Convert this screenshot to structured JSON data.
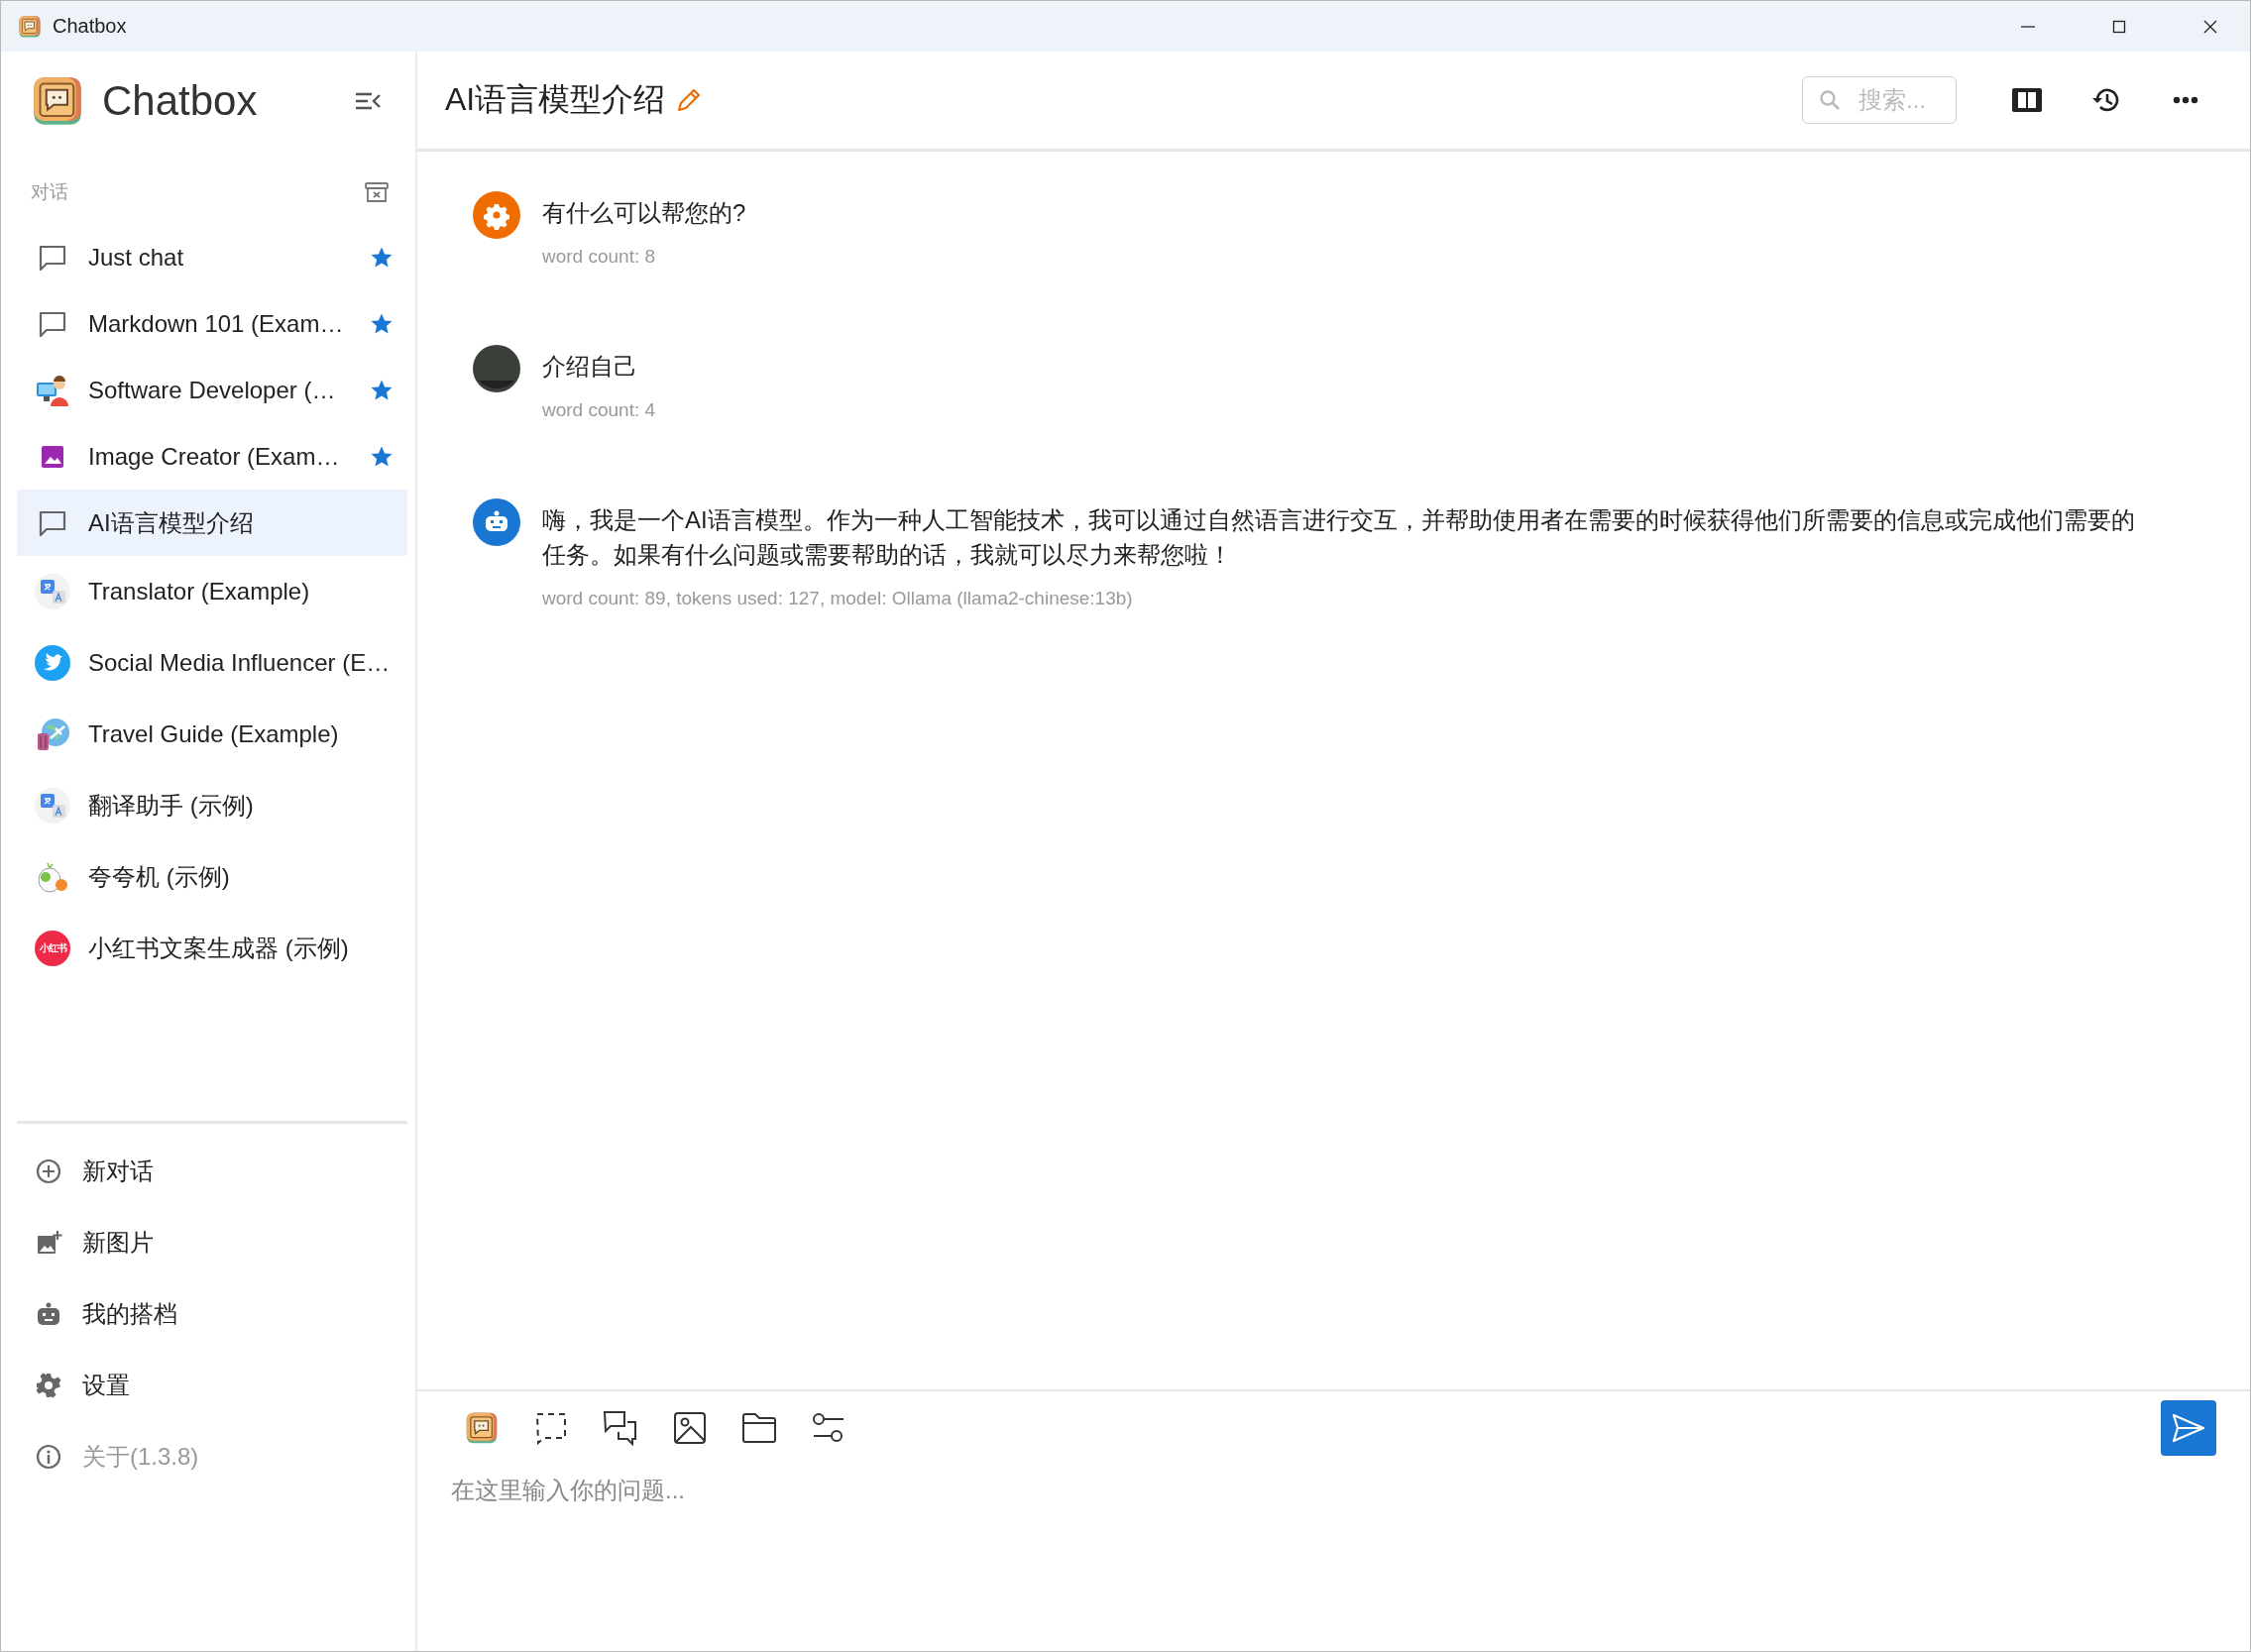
{
  "window": {
    "title": "Chatbox"
  },
  "sidebar": {
    "app_name": "Chatbox",
    "section_label": "对话",
    "conversations": [
      {
        "title": "Just chat",
        "kind": "chat",
        "starred": true,
        "selected": false
      },
      {
        "title": "Markdown 101 (Exam…",
        "kind": "chat",
        "starred": true,
        "selected": false
      },
      {
        "title": "Software Developer (…",
        "kind": "developer",
        "starred": true,
        "selected": false
      },
      {
        "title": "Image Creator (Exam…",
        "kind": "image",
        "starred": true,
        "selected": false
      },
      {
        "title": "AI语言模型介绍",
        "kind": "chat",
        "starred": false,
        "selected": true
      },
      {
        "title": "Translator (Example)",
        "kind": "translator",
        "starred": false,
        "selected": false
      },
      {
        "title": "Social Media Influencer (E…",
        "kind": "bird",
        "starred": false,
        "selected": false
      },
      {
        "title": "Travel Guide (Example)",
        "kind": "travel",
        "starred": false,
        "selected": false
      },
      {
        "title": "翻译助手 (示例)",
        "kind": "translator",
        "starred": false,
        "selected": false
      },
      {
        "title": "夸夸机 (示例)",
        "kind": "mascot",
        "starred": false,
        "selected": false
      },
      {
        "title": "小红书文案生成器 (示例)",
        "kind": "badge",
        "starred": false,
        "selected": false,
        "badge": "小红书"
      }
    ],
    "menu": [
      {
        "label": "新对话",
        "kind": "plus",
        "muted": false
      },
      {
        "label": "新图片",
        "kind": "addimage",
        "muted": false
      },
      {
        "label": "我的搭档",
        "kind": "robot",
        "muted": false
      },
      {
        "label": "设置",
        "kind": "gear",
        "muted": false
      },
      {
        "label": "关于(1.3.8)",
        "kind": "info",
        "muted": true
      }
    ]
  },
  "header": {
    "title": "AI语言模型介绍",
    "search": {
      "placeholder": "搜索..."
    }
  },
  "messages": [
    {
      "kind": "system",
      "text": "有什么可以帮您的?",
      "meta": "word count: 8"
    },
    {
      "kind": "user",
      "text": "介绍自己",
      "meta": "word count: 4"
    },
    {
      "kind": "assistant",
      "text": "嗨，我是一个AI语言模型。作为一种人工智能技术，我可以通过自然语言进行交互，并帮助使用者在需要的时候获得他们所需要的信息或完成他们需要的任务。如果有什么问题或需要帮助的话，我就可以尽力来帮您啦！",
      "meta": "word count: 89, tokens used: 127, model: Ollama (llama2-chinese:13b)"
    }
  ],
  "composer": {
    "placeholder": "在这里输入你的问题..."
  }
}
